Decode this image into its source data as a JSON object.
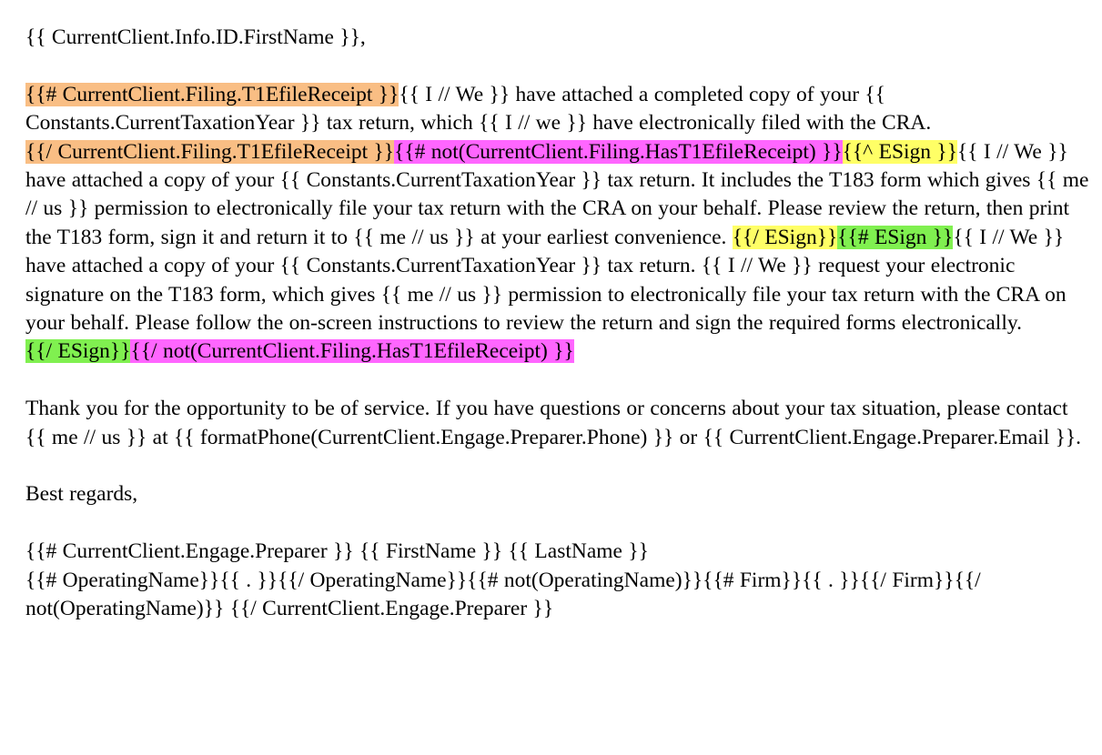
{
  "document": {
    "kind": "email-merge-template",
    "colors": {
      "background": "#ffffff",
      "text": "#000000",
      "highlight_orange": "#f9be84",
      "highlight_magenta": "#ff66ff",
      "highlight_yellow": "#ffff66",
      "highlight_green": "#80f050"
    },
    "salutation": {
      "merge_field": "{{ CurrentClient.Info.ID.FirstName }}",
      "comma": ","
    },
    "body": {
      "segments": [
        {
          "id": "seg-open-t1efilereceipt",
          "highlight": "orange",
          "text": "{{# CurrentClient.Filing.T1EfileReceipt }}"
        },
        {
          "id": "seg-text-1",
          "highlight": "none",
          "text": "{{ I // We }} have attached a completed copy of your {{ Constants.CurrentTaxationYear }} tax return, which {{ I // we }} have electronically filed with the CRA. "
        },
        {
          "id": "seg-close-t1efilereceipt",
          "highlight": "orange",
          "text": "{{/ CurrentClient.Filing.T1EfileReceipt }}"
        },
        {
          "id": "seg-open-not-hast1efilereceipt",
          "highlight": "magenta",
          "text": "{{# not(CurrentClient.Filing.HasT1EfileReceipt) }}"
        },
        {
          "id": "seg-inverted-esign",
          "highlight": "yellow",
          "text": "{{^ ESign }}"
        },
        {
          "id": "seg-text-2",
          "highlight": "none",
          "text": "{{ I // We }} have attached a copy of your {{ Constants.CurrentTaxationYear }} tax return. It includes the T183 form which gives {{ me // us }} permission to electronically file your tax return with the CRA on your behalf. Please review the return, then print the T183 form, sign it and return it to {{ me // us }} at your earliest convenience. "
        },
        {
          "id": "seg-close-esign-inverted",
          "highlight": "yellow",
          "text": "{{/ ESign}}"
        },
        {
          "id": "seg-open-esign",
          "highlight": "green",
          "text": "{{# ESign }}"
        },
        {
          "id": "seg-text-3",
          "highlight": "none",
          "text": "{{ I // We }} have attached a copy of your {{ Constants.CurrentTaxationYear }} tax return. {{ I // We }} request your electronic signature on the T183 form, which gives {{ me // us }} permission to electronically file your tax return with the CRA on your behalf. Please follow the on-screen instructions to review the return and sign the required forms electronically."
        },
        {
          "id": "seg-close-esign",
          "highlight": "green",
          "text": "{{/ ESign}}"
        },
        {
          "id": "seg-close-not-hast1efilereceipt",
          "highlight": "magenta",
          "text": "{{/ not(CurrentClient.Filing.HasT1EfileReceipt) }}"
        }
      ]
    },
    "closing_paragraph": "Thank you for the opportunity to be of service. If you have questions or concerns about your tax situation, please contact {{ me // us }} at {{ formatPhone(CurrentClient.Engage.Preparer.Phone) }} or {{ CurrentClient.Engage.Preparer.Email }}.",
    "signoff": "Best regards,",
    "signature_block": {
      "line1": "{{# CurrentClient.Engage.Preparer }} {{ FirstName }} {{ LastName }}",
      "line2": "{{# OperatingName}}{{ . }}{{/ OperatingName}}{{# not(OperatingName)}}{{# Firm}}{{ . }}{{/ Firm}}{{/ not(OperatingName)}} {{/ CurrentClient.Engage.Preparer }}"
    }
  }
}
